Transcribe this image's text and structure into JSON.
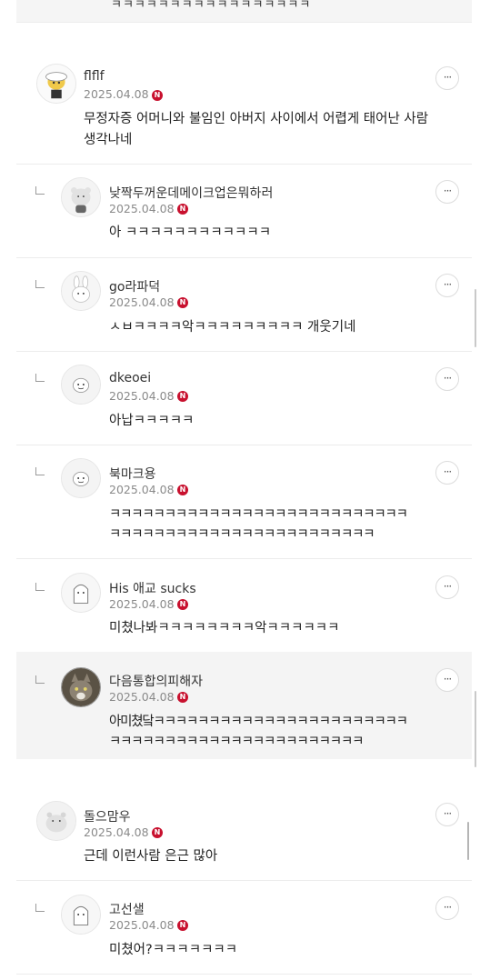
{
  "top_text": "ㅋㅋㅋㅋㅋㅋㅋㅋㅋㅋㅋㅋㅋㅋㅋㅋㅋ",
  "comments": [
    {
      "nick": "flflf",
      "date": "2025.04.08",
      "badge": "N",
      "lines": [
        "무정자증 어머니와 불임인 아버지 사이에서 어렵게 태어난 사람",
        "생각나네"
      ],
      "more": "···"
    },
    {
      "nick": "낮짝두꺼운데메이크업은뭐하러",
      "date": "2025.04.08",
      "badge": "N",
      "lines": [
        "아 ㅋㅋㅋㅋㅋㅋㅋㅋㅋㅋㅋㅋ"
      ],
      "more": "···"
    },
    {
      "nick": "go라파덕",
      "date": "2025.04.08",
      "badge": "N",
      "lines": [
        "ㅅㅂㅋㅋㅋㅋ악ㅋㅋㅋㅋㅋㅋㅋㅋㅋ 개웃기네"
      ],
      "more": "···"
    },
    {
      "nick": "dkeoei",
      "date": "2025.04.08",
      "badge": "N",
      "lines": [
        "아납ㅋㅋㅋㅋㅋ"
      ],
      "more": "···"
    },
    {
      "nick": "북마크용",
      "date": "2025.04.08",
      "badge": "N",
      "lines": [
        "ㅋㅋㅋㅋㅋㅋㅋㅋㅋㅋㅋㅋㅋㅋㅋㅋㅋㅋㅋㅋㅋㅋㅋㅋㅋㅋㅋ",
        "ㅋㅋㅋㅋㅋㅋㅋㅋㅋㅋㅋㅋㅋㅋㅋㅋㅋㅋㅋㅋㅋㅋㅋㅋ"
      ],
      "more": "···"
    },
    {
      "nick": "His 애교 sucks",
      "date": "2025.04.08",
      "badge": "N",
      "lines": [
        "미쳤나봐ㅋㅋㅋㅋㅋㅋㅋㅋ악ㅋㅋㅋㅋㅋㅋ"
      ],
      "more": "···"
    },
    {
      "nick": "다음통합의피해자",
      "date": "2025.04.08",
      "badge": "N",
      "lines": [
        "아미쳤닼ㅋㅋㅋㅋㅋㅋㅋㅋㅋㅋㅋㅋㅋㅋㅋㅋㅋㅋㅋㅋㅋㅋㅋ",
        "ㅋㅋㅋㅋㅋㅋㅋㅋㅋㅋㅋㅋㅋㅋㅋㅋㅋㅋㅋㅋㅋㅋㅋ"
      ],
      "more": "···"
    },
    {
      "nick": "돌으맘우",
      "date": "2025.04.08",
      "badge": "N",
      "lines": [
        "근데 이런사람 은근 많아"
      ],
      "more": "···"
    },
    {
      "nick": "고선샐",
      "date": "2025.04.08",
      "badge": "N",
      "lines": [
        "미쳤어?ㅋㅋㅋㅋㅋㅋㅋ"
      ],
      "more": "···"
    }
  ]
}
